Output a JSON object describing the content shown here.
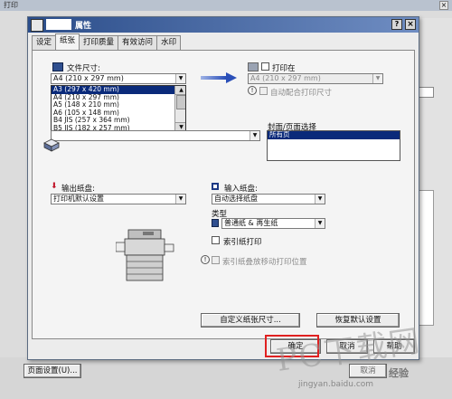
{
  "background_window": {
    "title": "打印",
    "close": "×",
    "page_setup_button": "页面设置(U)...",
    "cancel_partial": "取消"
  },
  "dialog": {
    "title": "属性",
    "help_icon": "?",
    "close_icon": "×",
    "tabs": [
      "设定",
      "纸张",
      "打印质量",
      "有效访问",
      "水印"
    ],
    "active_tab": 1
  },
  "paper_size": {
    "label": "文件尺寸:",
    "selected": "A4 (210 x 297 mm)",
    "options": [
      "A3 (297 x 420 mm)",
      "A4 (210 x 297 mm)",
      "A5 (148 x 210 mm)",
      "A6 (105 x 148 mm)",
      "B4 JIS (257 x 364 mm)",
      "B5 JIS (182 x 257 mm)"
    ],
    "highlighted_option": 0
  },
  "print_on": {
    "label": "打印在",
    "value": "A4 (210 x 297 mm)",
    "auto_fit_label": "自动配合打印尺寸"
  },
  "cover": {
    "label": "封面/页面选择",
    "items": [
      "所有页"
    ]
  },
  "output_tray": {
    "label": "输出纸盘:",
    "value": "打印机默认设置"
  },
  "input_tray": {
    "label": "输入纸盘:",
    "value": "自动选择纸盘"
  },
  "paper_type": {
    "label": "类型",
    "value": "普通纸 & 再生纸"
  },
  "index_paper": {
    "label": "索引纸打印",
    "shift_label": "索引纸叠放移动打印位置"
  },
  "buttons": {
    "custom_size": "自定义纸张尺寸...",
    "restore_defaults": "恢复默认设置",
    "ok": "确定",
    "cancel": "取消",
    "help": "帮助"
  },
  "watermark": {
    "text": "PC下载网",
    "url": "jingyan.baidu.com",
    "badge": "经验"
  },
  "colors": {
    "title_bar_start": "#2b4d8a",
    "selection": "#0a2a7a",
    "highlight_box": "#e02020"
  }
}
